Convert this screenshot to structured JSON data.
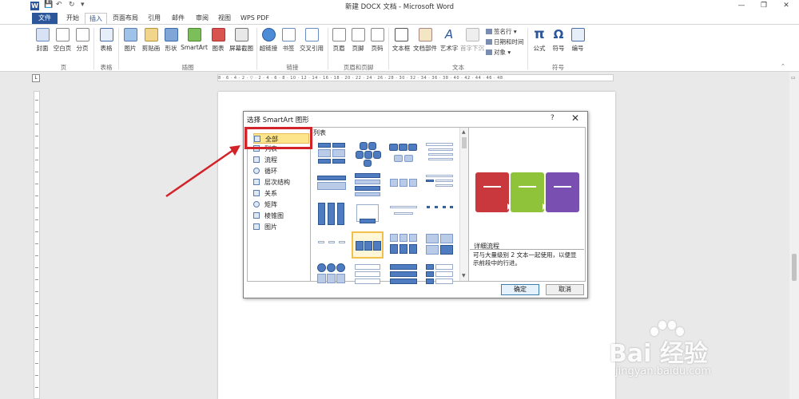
{
  "window": {
    "title": "新建 DOCX 文档 - Microsoft Word",
    "logo_letter": "W",
    "quick_access": [
      "💾",
      "↶",
      "↻",
      "▾"
    ]
  },
  "tabs": [
    "文件",
    "开始",
    "插入",
    "页面布局",
    "引用",
    "邮件",
    "审阅",
    "视图",
    "WPS PDF"
  ],
  "ribbon": {
    "buttons": [
      "封面",
      "空白页",
      "分页",
      "表格",
      "图片",
      "剪贴画",
      "形状",
      "SmartArt",
      "图表",
      "屏幕截图",
      "超链接",
      "书签",
      "交叉引用",
      "页眉",
      "页脚",
      "页码",
      "文本框",
      "文档部件",
      "艺术字",
      "首字下沉",
      "公式",
      "符号",
      "编号"
    ],
    "small": [
      "签名行 ▾",
      "日期和时间",
      "对象 ▾"
    ],
    "groups": [
      "页",
      "表格",
      "插图",
      "链接",
      "页眉和页脚",
      "文本",
      "符号"
    ]
  },
  "ruler": {
    "corner": "L",
    "numbers": "8 · 6 · 4 · 2 · ▽ · 2 · 4 · 6 · 8 · 10 · 12 · 14 · 16 · 18 · 20 · 22 · 24 · 26 · 28 · 30 · 32 · 34 · 36 · 38 · 40 · 42 · 44 · 46 · 48"
  },
  "dialog": {
    "title": "选择 SmartArt 图形",
    "help": "?",
    "close": "✕",
    "categories": [
      "全部",
      "列表",
      "流程",
      "循环",
      "层次结构",
      "关系",
      "矩阵",
      "棱锥图",
      "图片"
    ],
    "selected_category": "全部",
    "list_header": "列表",
    "preview_name": "详细流程",
    "preview_desc": "可与大量级别 2 文本一起使用，以便显示前段中的行进。",
    "ok": "确定",
    "cancel": "取消"
  },
  "preview_colors": [
    "#c8383d",
    "#8fc43a",
    "#7a4fb2"
  ],
  "watermark": {
    "brand": "Bai 经验",
    "url": "jingyan.baidu.com"
  }
}
